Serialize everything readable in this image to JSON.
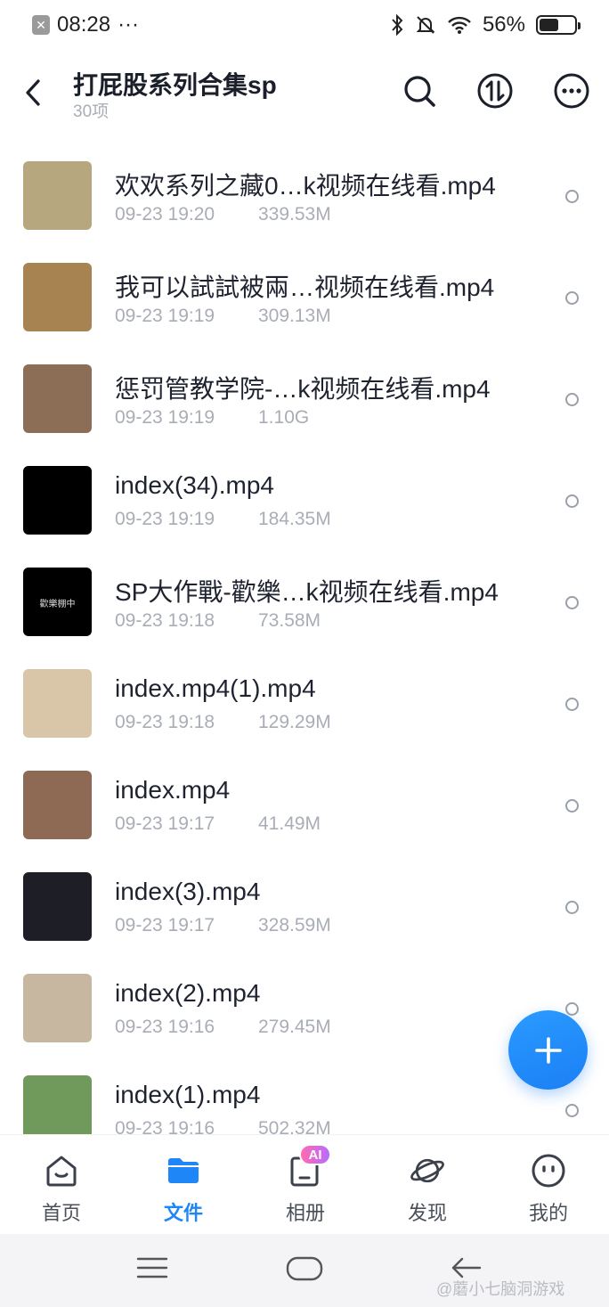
{
  "status_bar": {
    "time": "08:28",
    "more": "···",
    "battery": "56%",
    "battery_level": 0.56
  },
  "header": {
    "title": "打屁股系列合集sp",
    "subtitle": "30项"
  },
  "files": [
    {
      "name": "欢欢系列之藏0…k视频在线看.mp4",
      "date": "09-23 19:20",
      "size": "339.53M",
      "thumb_bg": "#b7a77f",
      "thumb_text": ""
    },
    {
      "name": "我可以試試被兩…视频在线看.mp4",
      "date": "09-23 19:19",
      "size": "309.13M",
      "thumb_bg": "#a88352",
      "thumb_text": ""
    },
    {
      "name": "惩罚管教学院-…k视频在线看.mp4",
      "date": "09-23 19:19",
      "size": "1.10G",
      "thumb_bg": "#8c6e56",
      "thumb_text": ""
    },
    {
      "name": "index(34).mp4",
      "date": "09-23 19:19",
      "size": "184.35M",
      "thumb_bg": "#000000",
      "thumb_text": ""
    },
    {
      "name": "SP大作戰-歡樂…k视频在线看.mp4",
      "date": "09-23 19:18",
      "size": "73.58M",
      "thumb_bg": "#000000",
      "thumb_text": "歡樂棚中"
    },
    {
      "name": "index.mp4(1).mp4",
      "date": "09-23 19:18",
      "size": "129.29M",
      "thumb_bg": "#d9c6a8",
      "thumb_text": ""
    },
    {
      "name": "index.mp4",
      "date": "09-23 19:17",
      "size": "41.49M",
      "thumb_bg": "#8e6a55",
      "thumb_text": ""
    },
    {
      "name": "index(3).mp4",
      "date": "09-23 19:17",
      "size": "328.59M",
      "thumb_bg": "#1e1e26",
      "thumb_text": ""
    },
    {
      "name": "index(2).mp4",
      "date": "09-23 19:16",
      "size": "279.45M",
      "thumb_bg": "#c7b7a0",
      "thumb_text": ""
    },
    {
      "name": "index(1).mp4",
      "date": "09-23 19:16",
      "size": "502.32M",
      "thumb_bg": "#6f9a5c",
      "thumb_text": ""
    }
  ],
  "bottom_nav": [
    {
      "label": "首页",
      "icon": "home-icon"
    },
    {
      "label": "文件",
      "icon": "folder-icon"
    },
    {
      "label": "相册",
      "icon": "album-icon",
      "badge": "AI"
    },
    {
      "label": "发现",
      "icon": "planet-icon"
    },
    {
      "label": "我的",
      "icon": "profile-icon"
    }
  ],
  "watermark": "@蘑小七脑洞游戏",
  "colors": {
    "accent": "#1e86f6",
    "text_primary": "#1f2330",
    "text_secondary": "#a9adb5"
  }
}
